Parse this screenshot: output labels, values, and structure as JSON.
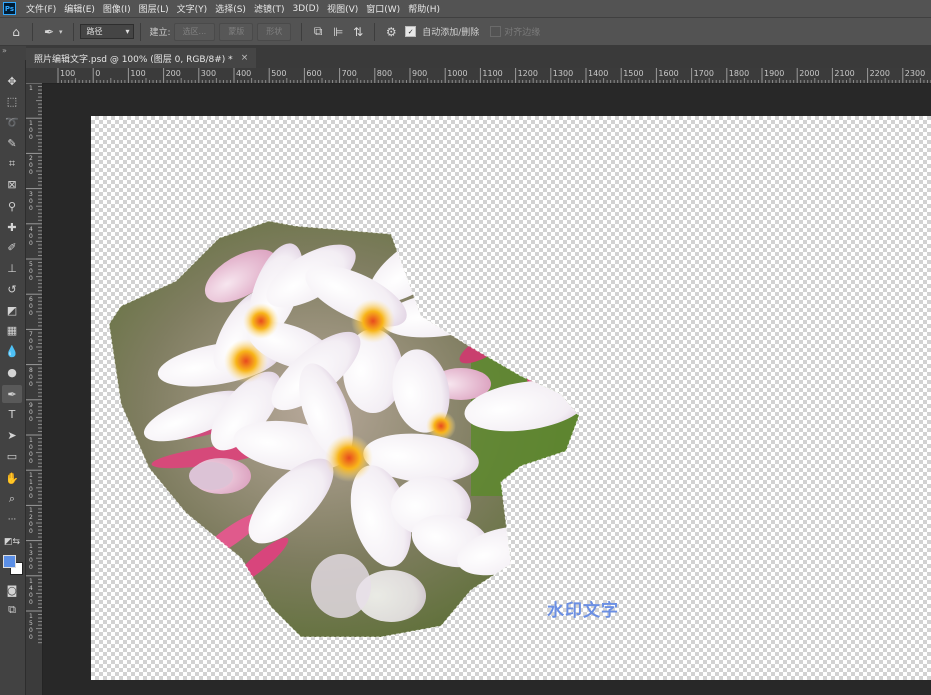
{
  "app": {
    "logo_text": "Ps"
  },
  "menu": [
    "文件(F)",
    "编辑(E)",
    "图像(I)",
    "图层(L)",
    "文字(Y)",
    "选择(S)",
    "滤镜(T)",
    "3D(D)",
    "视图(V)",
    "窗口(W)",
    "帮助(H)"
  ],
  "options": {
    "mode_value": "路径",
    "make_label": "建立:",
    "selection_button": "选区...",
    "mask_button": "蒙版",
    "shape_button": "形状",
    "auto_add_delete_label": "自动添加/删除",
    "auto_add_delete_checked": true,
    "align_edges_label": "对齐边缘",
    "align_edges_checked": false
  },
  "document": {
    "tab_title": "照片编辑文字.psd @ 100% (图层 0, RGB/8#) *",
    "close_glyph": "×"
  },
  "rulers": {
    "top": [
      "100",
      "0",
      "100",
      "200",
      "300",
      "400",
      "500",
      "600",
      "700",
      "800",
      "900",
      "1000",
      "1100",
      "1200",
      "1300",
      "1400",
      "1500",
      "1600",
      "1700",
      "1800",
      "1900",
      "2000",
      "2100",
      "2200",
      "2300"
    ],
    "left": [
      "1",
      "1 0 0",
      "2 0 0",
      "3 0 0",
      "4 0 0",
      "5 0 0",
      "6 0 0",
      "7 0 0",
      "8 0 0",
      "9 0 0",
      "1 0 0 0",
      "1 1 0 0",
      "1 2 0 0",
      "1 3 0 0",
      "1 4 0 0",
      "1 5 0 0"
    ]
  },
  "tools": [
    {
      "name": "move-tool-icon",
      "glyph": "✥"
    },
    {
      "name": "marquee-tool-icon",
      "glyph": "⬚"
    },
    {
      "name": "lasso-tool-icon",
      "glyph": "➰"
    },
    {
      "name": "quick-select-tool-icon",
      "glyph": "✎"
    },
    {
      "name": "crop-tool-icon",
      "glyph": "⌗"
    },
    {
      "name": "frame-tool-icon",
      "glyph": "⊠"
    },
    {
      "name": "eyedropper-tool-icon",
      "glyph": "⚲"
    },
    {
      "name": "healing-brush-tool-icon",
      "glyph": "✚"
    },
    {
      "name": "brush-tool-icon",
      "glyph": "✐"
    },
    {
      "name": "clone-stamp-tool-icon",
      "glyph": "⊥"
    },
    {
      "name": "history-brush-tool-icon",
      "glyph": "↺"
    },
    {
      "name": "eraser-tool-icon",
      "glyph": "◩"
    },
    {
      "name": "gradient-tool-icon",
      "glyph": "▦"
    },
    {
      "name": "blur-tool-icon",
      "glyph": "💧"
    },
    {
      "name": "dodge-tool-icon",
      "glyph": "●"
    },
    {
      "name": "pen-tool-icon",
      "glyph": "✒",
      "active": true
    },
    {
      "name": "type-tool-icon",
      "glyph": "T"
    },
    {
      "name": "path-select-tool-icon",
      "glyph": "➤"
    },
    {
      "name": "shape-tool-icon",
      "glyph": "▭"
    },
    {
      "name": "hand-tool-icon",
      "glyph": "✋"
    },
    {
      "name": "zoom-tool-icon",
      "glyph": "⌕"
    },
    {
      "name": "more-tools-icon",
      "glyph": "···"
    }
  ],
  "colors": {
    "foreground": "#5b8fe6",
    "background": "#ffffff"
  },
  "canvas": {
    "watermark_text": "水印文字",
    "watermark_color": "#6b8fe3"
  }
}
